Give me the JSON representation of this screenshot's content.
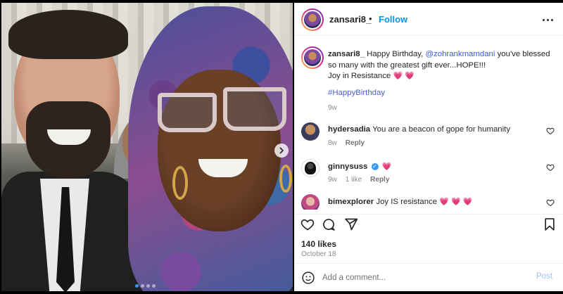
{
  "post": {
    "author": "zansari8_",
    "separator": "•",
    "follow_label": "Follow",
    "caption": {
      "author": "zansari8_",
      "text_before_mention": "Happy Birthday,",
      "mention": "@zohrankmamdani",
      "text_after_mention": "you've blessed so many with the greatest gift ever...HOPE!!!",
      "line2": "Joy in Resistance",
      "line2_emoji": "💗 💗",
      "hashtag": "#HappyBirthday",
      "time": "9w"
    },
    "comments": [
      {
        "user": "hydersadia",
        "text": "You are a beacon of gope for humanity",
        "time": "8w",
        "likes": "",
        "reply": "Reply"
      },
      {
        "user": "ginnysuss",
        "verified": "✓",
        "text": "💗",
        "time": "9w",
        "likes": "1 like",
        "reply": "Reply"
      },
      {
        "user": "bimexplorer",
        "text": "Joy IS resistance",
        "emoji": "💗 💗 💗"
      }
    ],
    "likes_count": "140 likes",
    "date": "October 18",
    "add_comment_placeholder": "Add a comment...",
    "post_label": "Post"
  },
  "icons": {
    "next": "chevron-right-icon",
    "like": "heart-icon",
    "comment": "comment-icon",
    "share": "share-icon",
    "save": "bookmark-icon",
    "emoji": "emoji-icon",
    "more": "more-icon"
  },
  "colors": {
    "link": "#3a5ccc",
    "follow": "#0095f6",
    "heart": "#e0245e",
    "carousel_active": "#3897f0"
  }
}
